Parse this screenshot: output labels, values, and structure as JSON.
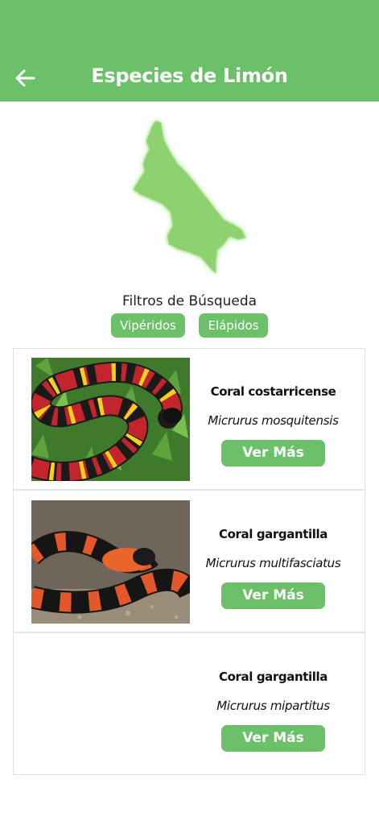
{
  "header": {
    "title": "Especies de Limón",
    "back_icon": "arrow-left-icon",
    "background": "#6cc06a"
  },
  "map": {
    "icon": "limon-province-map",
    "color": "#8ed16f"
  },
  "filters": {
    "title": "Filtros de Búsqueda",
    "chips": [
      "Vipéridos",
      "Elápidos"
    ]
  },
  "species": [
    {
      "name": "Coral costarricense",
      "scientific": "Micrurus mosquitensis",
      "button": "Ver Más",
      "image": "coral-costarricense-photo"
    },
    {
      "name": "Coral gargantilla",
      "scientific": "Micrurus multifasciatus",
      "button": "Ver Más",
      "image": "coral-gargantilla-photo"
    },
    {
      "name": "Coral gargantilla",
      "scientific": "Micrurus mipartitus",
      "button": "Ver Más",
      "image": ""
    }
  ],
  "colors": {
    "accent": "#6cc06a",
    "text": "#111111",
    "border": "#e0e0e0"
  }
}
